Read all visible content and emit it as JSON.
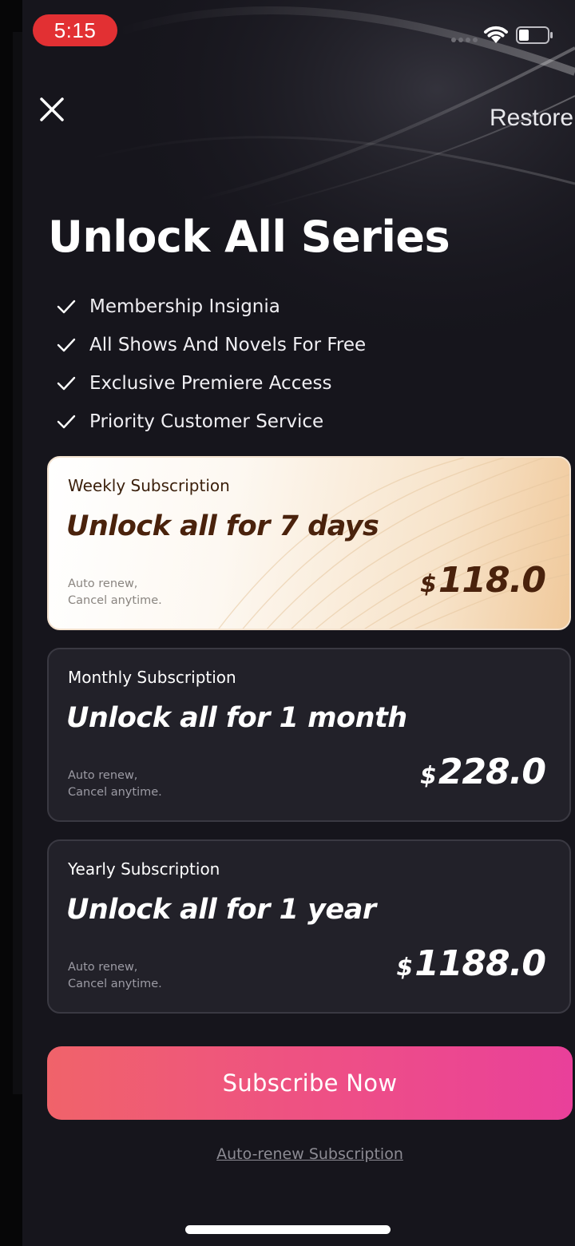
{
  "status_bar": {
    "time": "5:15"
  },
  "header": {
    "close_icon": "close-icon",
    "restore_label": "Restore"
  },
  "title": "Unlock All Series",
  "benefits": [
    "Membership Insignia",
    "All Shows And Novels For Free",
    "Exclusive Premiere Access",
    "Priority Customer Service"
  ],
  "plans": [
    {
      "name": "Weekly Subscription",
      "headline": "Unlock all for 7 days",
      "note_line1": "Auto renew,",
      "note_line2": "Cancel anytime.",
      "currency": "$",
      "price": "118.0",
      "selected": true
    },
    {
      "name": "Monthly Subscription",
      "headline": "Unlock all for 1 month",
      "note_line1": "Auto renew,",
      "note_line2": "Cancel anytime.",
      "currency": "$",
      "price": "228.0",
      "selected": false
    },
    {
      "name": "Yearly Subscription",
      "headline": "Unlock all for 1 year",
      "note_line1": "Auto renew,",
      "note_line2": "Cancel anytime.",
      "currency": "$",
      "price": "1188.0",
      "selected": false
    }
  ],
  "cta": {
    "subscribe_label": "Subscribe Now",
    "terms_label": "Auto-renew Subscription"
  },
  "colors": {
    "background": "#16151c",
    "card": "#222129",
    "accent_start": "#f0636a",
    "accent_end": "#e9409a",
    "selected_text": "#4a220c",
    "time_pill": "#e23033"
  }
}
